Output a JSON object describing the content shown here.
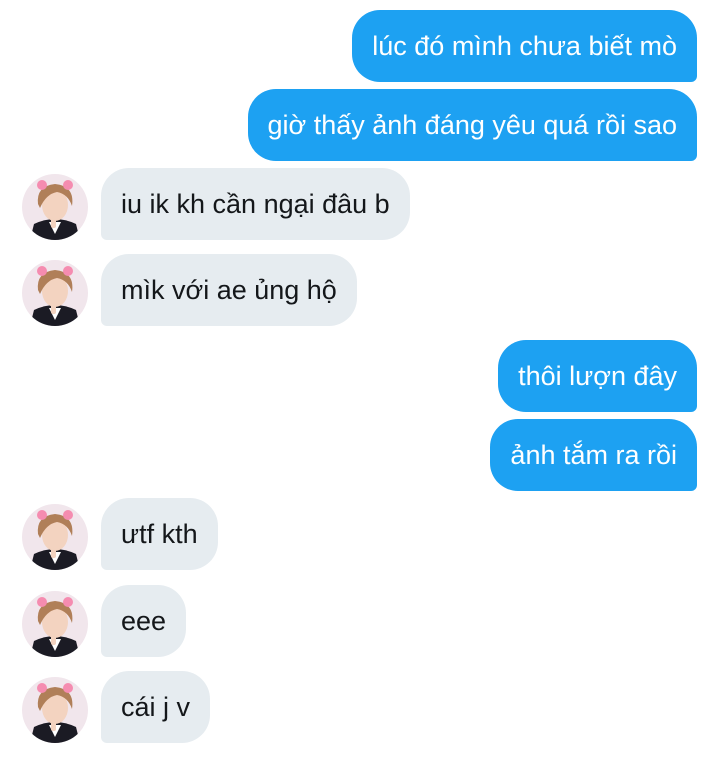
{
  "conversation": {
    "messages": [
      {
        "direction": "out",
        "text": "lúc đó mình chưa biết mò"
      },
      {
        "direction": "out",
        "text": "giờ thấy ảnh đáng yêu quá rồi sao"
      },
      {
        "direction": "in",
        "text": "iu ik kh cần ngại đâu b",
        "avatar": "user-avatar"
      },
      {
        "direction": "in",
        "text": "mìk với ae ủng hộ",
        "avatar": "user-avatar"
      },
      {
        "direction": "out",
        "text": "thôi lượn đây"
      },
      {
        "direction": "out",
        "text": "ảnh tắm ra rồi"
      },
      {
        "direction": "in",
        "text": "ưtf kth",
        "avatar": "user-avatar"
      },
      {
        "direction": "in",
        "text": "eee",
        "avatar": "user-avatar"
      },
      {
        "direction": "in",
        "text": "cái j v",
        "avatar": "user-avatar"
      }
    ]
  },
  "colors": {
    "outgoing_bubble": "#1da1f2",
    "incoming_bubble": "#e6ecf0",
    "incoming_text": "#14171a",
    "outgoing_text": "#ffffff"
  }
}
